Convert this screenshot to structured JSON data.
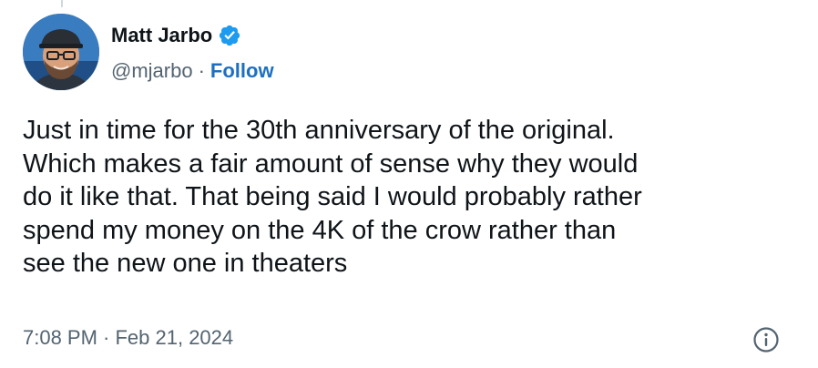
{
  "author": {
    "display_name": "Matt Jarbo",
    "handle": "@mjarbo",
    "separator": "·",
    "follow_label": "Follow",
    "verified": true
  },
  "tweet": {
    "text": "Just in time for the 30th anniversary of the original.\nWhich makes a fair amount of sense why they would\ndo it like that. That being said I would probably rather\nspend my money on the 4K of the crow rather than\nsee the new one in theaters",
    "timestamp": "7:08 PM · Feb 21, 2024"
  },
  "icons": {
    "verified": "verified-badge-icon",
    "info": "info-icon"
  },
  "colors": {
    "accent": "#1d9bf0",
    "follow": "#1d6fc1",
    "secondary_text": "#536471",
    "primary_text": "#0f1419"
  }
}
